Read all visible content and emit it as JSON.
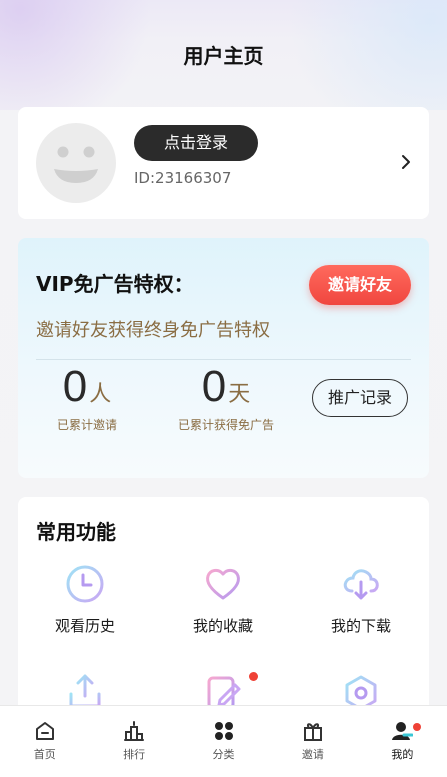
{
  "header": {
    "title": "用户主页"
  },
  "profile": {
    "login_label": "点击登录",
    "user_id": "ID:23166307"
  },
  "vip": {
    "title": "VIP免广告特权：",
    "invite_button": "邀请好友",
    "subtitle": "邀请好友获得终身免广告特权",
    "invited_count": "0",
    "invited_unit": "人",
    "invited_label": "已累计邀请",
    "days_count": "0",
    "days_unit": "天",
    "days_label": "已累计获得免广告",
    "record_button": "推广记录"
  },
  "features": {
    "title": "常用功能",
    "items": [
      {
        "label": "观看历史",
        "icon": "clock-icon"
      },
      {
        "label": "我的收藏",
        "icon": "heart-icon"
      },
      {
        "label": "我的下载",
        "icon": "cloud-download-icon"
      },
      {
        "label": "",
        "icon": "upload-icon"
      },
      {
        "label": "",
        "icon": "edit-icon"
      },
      {
        "label": "",
        "icon": "settings-icon"
      }
    ]
  },
  "nav": {
    "items": [
      {
        "label": "首页",
        "icon": "home-icon"
      },
      {
        "label": "排行",
        "icon": "ranking-icon"
      },
      {
        "label": "分类",
        "icon": "category-icon"
      },
      {
        "label": "邀请",
        "icon": "gift-icon"
      },
      {
        "label": "我的",
        "icon": "user-icon"
      }
    ],
    "active_index": 4
  },
  "colors": {
    "accent_red": "#f0463f",
    "gold_text": "#8a6d43",
    "vip_bg": "#dff3fb"
  }
}
